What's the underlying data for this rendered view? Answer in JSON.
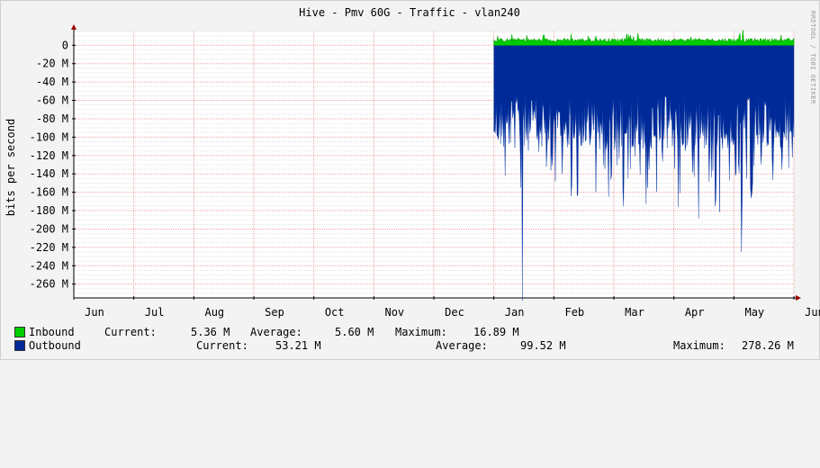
{
  "chart_data": {
    "type": "area",
    "title": "Hive - Pmv 60G - Traffic - vlan240",
    "ylabel": "bits per second",
    "watermark": "RRDTOOL / TOBI OETIKER",
    "ylim": [
      -275,
      15
    ],
    "y_unit": "M",
    "y_ticks": [
      {
        "value": 0,
        "label": "0"
      },
      {
        "value": -20,
        "label": "-20 M"
      },
      {
        "value": -40,
        "label": "-40 M"
      },
      {
        "value": -60,
        "label": "-60 M"
      },
      {
        "value": -80,
        "label": "-80 M"
      },
      {
        "value": -100,
        "label": "-100 M"
      },
      {
        "value": -120,
        "label": "-120 M"
      },
      {
        "value": -140,
        "label": "-140 M"
      },
      {
        "value": -160,
        "label": "-160 M"
      },
      {
        "value": -180,
        "label": "-180 M"
      },
      {
        "value": -200,
        "label": "-200 M"
      },
      {
        "value": -220,
        "label": "-220 M"
      },
      {
        "value": -240,
        "label": "-240 M"
      },
      {
        "value": -260,
        "label": "-260 M"
      }
    ],
    "x_months": [
      "Jun",
      "Jul",
      "Aug",
      "Sep",
      "Oct",
      "Nov",
      "Dec",
      "Jan",
      "Feb",
      "Mar",
      "Apr",
      "May",
      "Jun"
    ],
    "grid": true,
    "series": [
      {
        "name": "Inbound",
        "color": "#00cc00",
        "current": "5.36 M",
        "average": "5.60 M",
        "maximum": "16.89 M",
        "active_from_month": 7.0,
        "typical_value": 5.6,
        "peak_value": 16.89,
        "peak_month": 11.15
      },
      {
        "name": "Outbound",
        "color": "#002a97",
        "current": "53.21 M",
        "average": "99.52 M",
        "maximum": "278.26 M",
        "active_from_month": 7.0,
        "typical_value": 99.52,
        "peak_value": 278.26,
        "peak_month": 7.48,
        "secondary_peak_value": 225,
        "secondary_peak_month": 11.12
      }
    ]
  },
  "legend": {
    "current_label": "Current:",
    "average_label": "Average:",
    "maximum_label": "Maximum:"
  }
}
